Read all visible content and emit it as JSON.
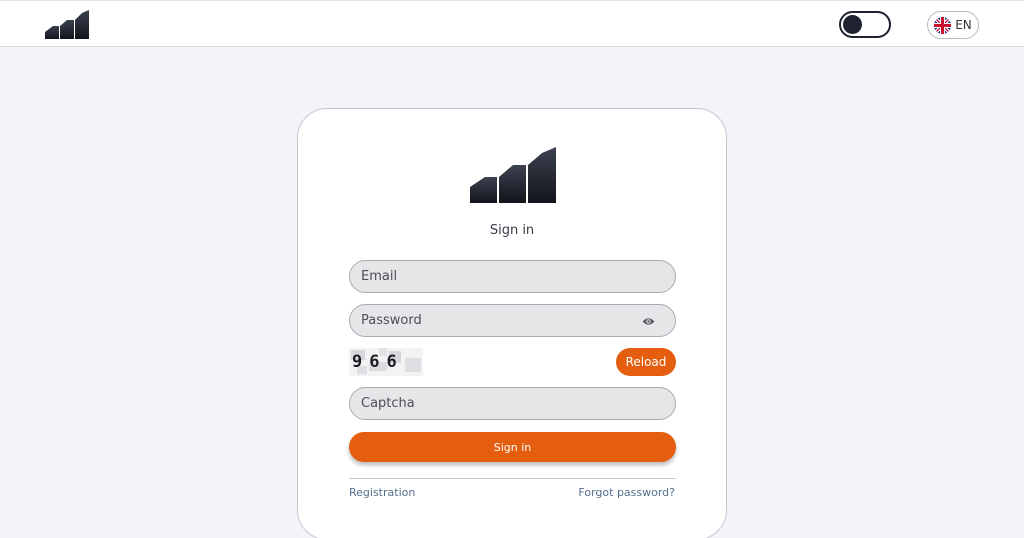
{
  "header": {
    "language_label": "EN",
    "icons": {
      "logo": "bar-chart-logo-icon",
      "theme": "moon-icon",
      "language": "uk-flag-icon"
    }
  },
  "login": {
    "title": "Sign in",
    "email_placeholder": "Email",
    "password_placeholder": "Password",
    "captcha_text": "966",
    "reload_label": "Reload",
    "captcha_placeholder": "Captcha",
    "submit_label": "Sign in",
    "registration_link": "Registration",
    "forgot_password_link": "Forgot password?"
  },
  "colors": {
    "accent": "#e55e10",
    "logo_dark": "#1f2230",
    "page_bg": "#f3f3f9",
    "link": "#556e8e"
  }
}
